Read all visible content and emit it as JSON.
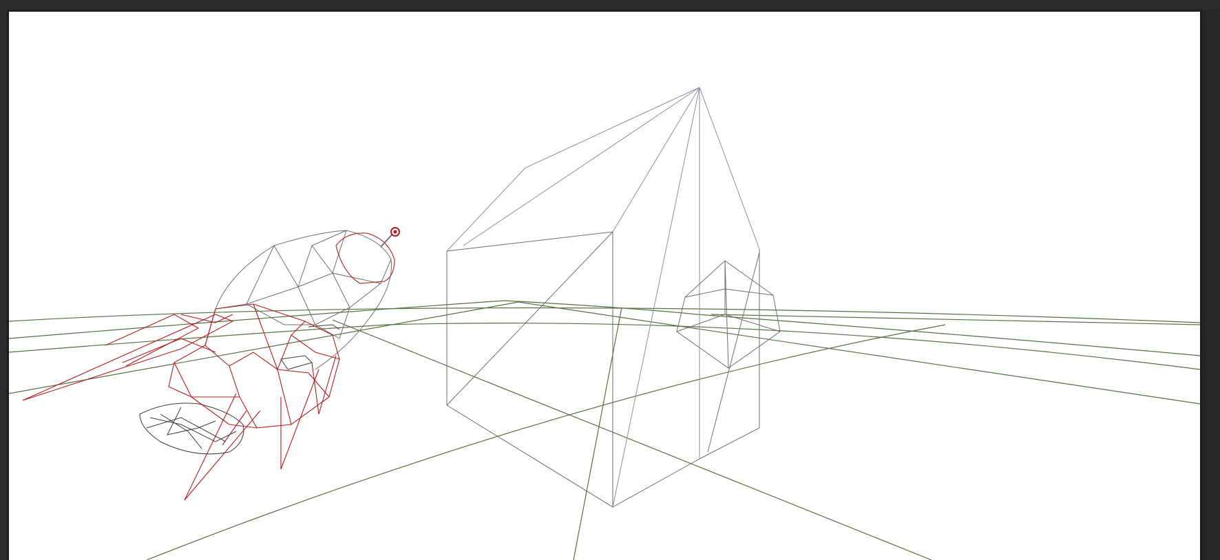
{
  "viewport": {
    "mode": "wireframe",
    "background_color": "#ffffff",
    "frame_color": "#1c1c1c"
  },
  "colors": {
    "ground_grid": "#56703f",
    "house_edges": "#6b6f6b",
    "house_roof_edges": "#8a8fa0",
    "selected_mesh": "#b31b1b",
    "unselected_mesh": "#6e6e6e",
    "dark_mesh": "#3a3a3a"
  },
  "objects": {
    "house": {
      "name": "house",
      "icon": "wireframe-house"
    },
    "cube": {
      "name": "cube",
      "icon": "wireframe-cube"
    },
    "rocket": {
      "name": "rocket",
      "icon": "wireframe-rocket",
      "selected": true
    },
    "gizmo": {
      "name": "pivot-gizmo",
      "icon": "target-icon"
    }
  }
}
